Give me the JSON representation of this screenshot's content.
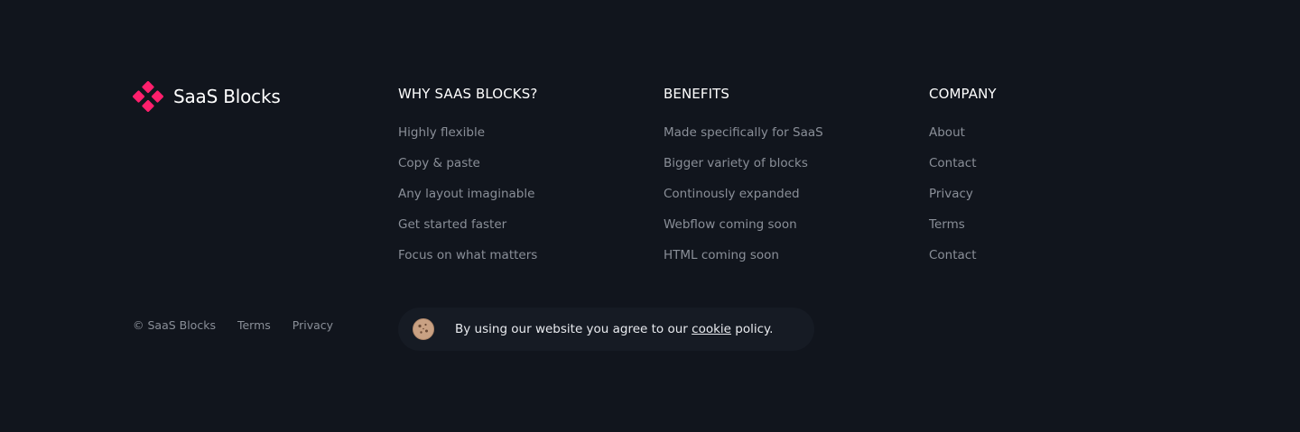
{
  "brand": {
    "name": "SaaS Blocks",
    "accent_color": "#ff1f6c",
    "icon": "diamond-cluster-logo"
  },
  "columns": [
    {
      "title": "WHY SAAS BLOCKS?",
      "links": [
        "Highly flexible",
        "Copy & paste",
        "Any layout imaginable",
        "Get started faster",
        "Focus on what matters"
      ]
    },
    {
      "title": "BENEFITS",
      "links": [
        "Made specifically for SaaS",
        "Bigger variety of blocks",
        "Continously expanded",
        "Webflow coming soon",
        "HTML coming soon"
      ]
    },
    {
      "title": "COMPANY",
      "links": [
        "About",
        "Contact",
        "Privacy",
        "Terms",
        "Contact"
      ]
    }
  ],
  "bottom": {
    "copyright": "© SaaS Blocks",
    "terms_label": "Terms",
    "privacy_label": "Privacy"
  },
  "cookie_banner": {
    "icon": "cookie-icon",
    "text_before": "By using our website you agree to our ",
    "link_label": "cookie",
    "text_after": " policy."
  },
  "colors": {
    "background": "#11151d",
    "banner_background": "#161b24",
    "muted_text": "#8a8f98",
    "heading_text": "#ffffff"
  }
}
